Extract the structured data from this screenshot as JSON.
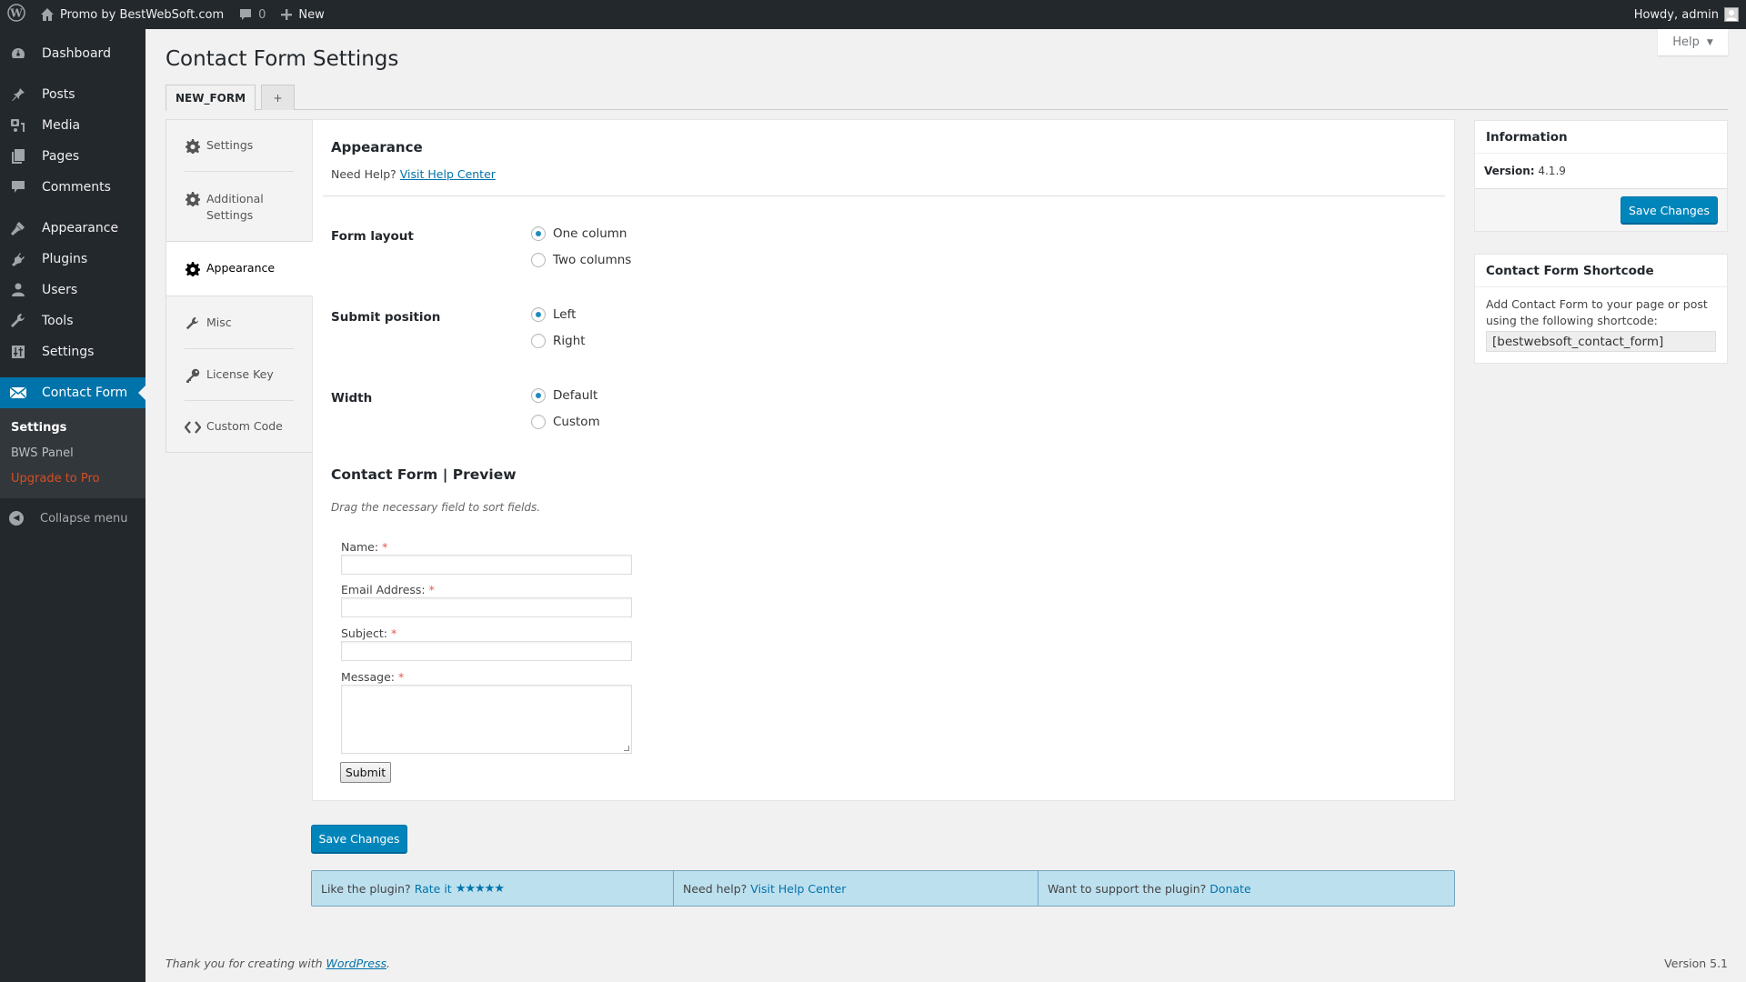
{
  "adminbar": {
    "site_name": "Promo by BestWebSoft.com",
    "comments_count": "0",
    "new_label": "New",
    "greeting": "Howdy, admin"
  },
  "sidebar": {
    "items": [
      {
        "label": "Dashboard",
        "icon": "dashboard-icon"
      },
      {
        "label": "Posts",
        "icon": "pin-icon"
      },
      {
        "label": "Media",
        "icon": "media-icon"
      },
      {
        "label": "Pages",
        "icon": "pages-icon"
      },
      {
        "label": "Comments",
        "icon": "comment-icon"
      },
      {
        "label": "Appearance",
        "icon": "brush-icon"
      },
      {
        "label": "Plugins",
        "icon": "plug-icon"
      },
      {
        "label": "Users",
        "icon": "user-icon"
      },
      {
        "label": "Tools",
        "icon": "wrench-icon"
      },
      {
        "label": "Settings",
        "icon": "sliders-icon"
      },
      {
        "label": "Contact Form",
        "icon": "envelope-icon"
      }
    ],
    "submenu": [
      {
        "label": "Settings"
      },
      {
        "label": "BWS Panel"
      },
      {
        "label": "Upgrade to Pro"
      }
    ],
    "collapse_label": "Collapse menu"
  },
  "header": {
    "help_label": "Help",
    "title": "Contact Form Settings"
  },
  "tabs": [
    {
      "label": "NEW_FORM"
    },
    {
      "label": "+"
    }
  ],
  "settings_nav": [
    {
      "label": "Settings",
      "icon": "gear-icon"
    },
    {
      "label": "Additional Settings",
      "icon": "gear-icon"
    },
    {
      "label": "Appearance",
      "icon": "gear-icon"
    },
    {
      "label": "Misc",
      "icon": "wrench-icon"
    },
    {
      "label": "License Key",
      "icon": "key-icon"
    },
    {
      "label": "Custom Code",
      "icon": "code-icon"
    }
  ],
  "main": {
    "section_title": "Appearance",
    "help_prefix": "Need Help?",
    "help_link": "Visit Help Center",
    "options": [
      {
        "label": "Form layout",
        "choices": [
          "One column",
          "Two columns"
        ],
        "selected": "One column"
      },
      {
        "label": "Submit position",
        "choices": [
          "Left",
          "Right"
        ],
        "selected": "Left"
      },
      {
        "label": "Width",
        "choices": [
          "Default",
          "Custom"
        ],
        "selected": "Default"
      }
    ],
    "preview_title": "Contact Form | Preview",
    "preview_desc": "Drag the necessary field to sort fields.",
    "preview_fields": [
      {
        "label": "Name:",
        "required": "*"
      },
      {
        "label": "Email Address:",
        "required": "*"
      },
      {
        "label": "Subject:",
        "required": "*"
      },
      {
        "label": "Message:",
        "required": "*"
      }
    ],
    "submit_label": "Submit",
    "save_label": "Save Changes"
  },
  "info_box": {
    "title": "Information",
    "version_label": "Version:",
    "version_value": "4.1.9",
    "save_label": "Save Changes"
  },
  "shortcode_box": {
    "title": "Contact Form Shortcode",
    "description": "Add Contact Form to your page or post using the following shortcode:",
    "shortcode": "[bestwebsoft_contact_form]"
  },
  "rate_bar": {
    "like_text": "Like the plugin?",
    "rate_link": "Rate it",
    "stars": "★★★★★",
    "help_text": "Need help?",
    "help_link": "Visit Help Center",
    "support_text": "Want to support the plugin?",
    "donate_link": "Donate"
  },
  "footer": {
    "thanks_prefix": "Thank you for creating with",
    "wp_link": "WordPress",
    "thanks_suffix": ".",
    "version": "Version 5.1"
  }
}
